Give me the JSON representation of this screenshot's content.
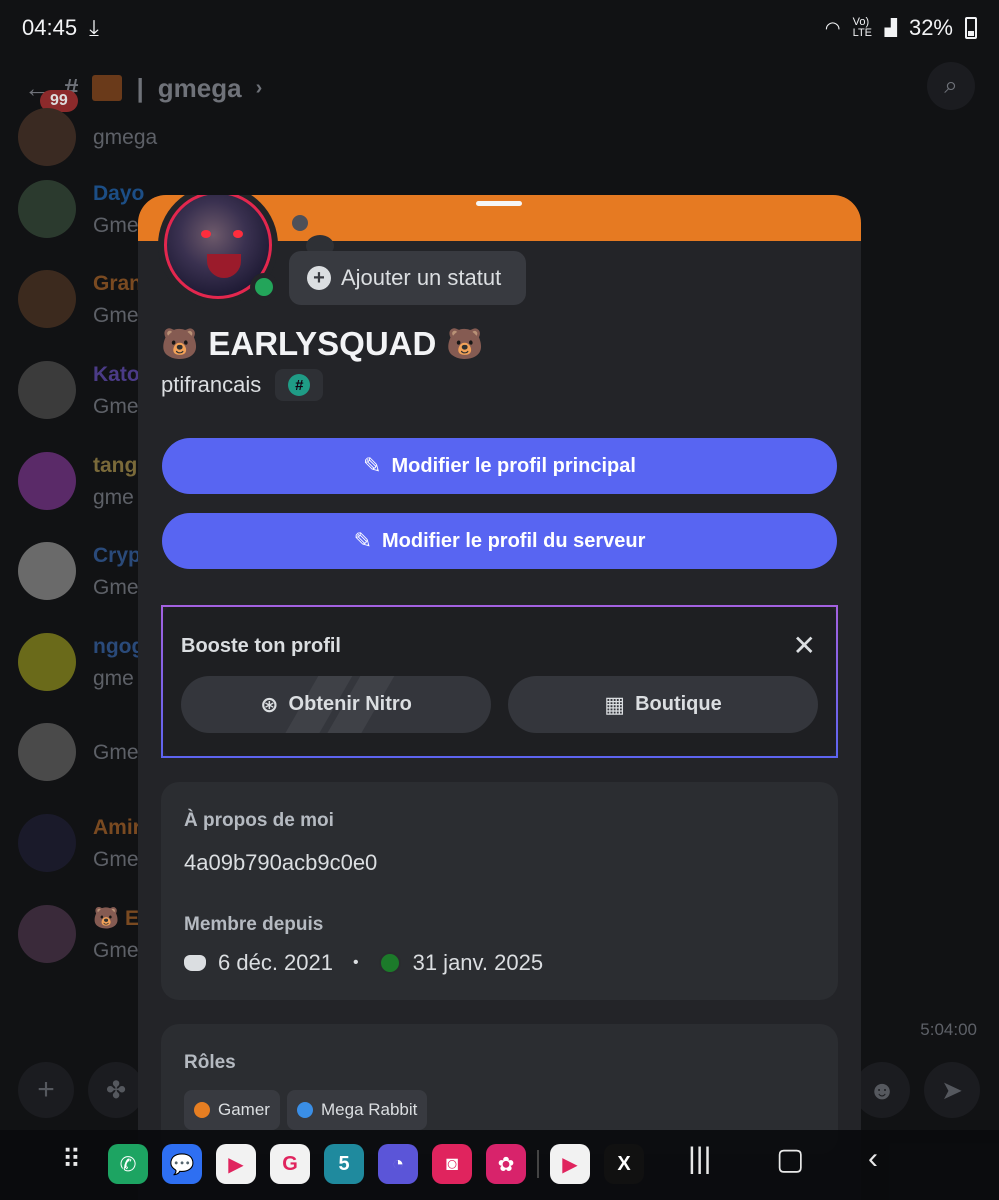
{
  "statusbar": {
    "time": "04:45",
    "battery": "32%",
    "net": "Vo) LTE"
  },
  "background": {
    "channel": "gmega",
    "badge": "99",
    "messages": [
      {
        "name": "",
        "text": "gmega",
        "color": "#5d6067",
        "avatar": "#3a2a22"
      },
      {
        "name": "Dayo",
        "text": "Gme",
        "color": "#1c4e86",
        "avatar": "#2b3a2e"
      },
      {
        "name": "Gran",
        "text": "Gme",
        "color": "#7a4a21",
        "avatar": "#3c2a1e"
      },
      {
        "name": "Kato",
        "text": "Gme",
        "color": "#4b3b87",
        "avatar": "#3b3b3b"
      },
      {
        "name": "tang",
        "text": "gme",
        "color": "#7a6a3a",
        "avatar": "#5a2a68"
      },
      {
        "name": "Cryp",
        "text": "Gme",
        "color": "#2a4a7a",
        "avatar": "#6a6a6a"
      },
      {
        "name": "ngog",
        "text": "gme",
        "color": "#2a4a7a",
        "avatar": "#6a6a1a"
      },
      {
        "name": "",
        "text": "Gme",
        "color": "#4a2a6a",
        "avatar": "#4a4a4a"
      },
      {
        "name": "Amir",
        "text": "Gme",
        "color": "#7a4a21",
        "avatar": "#1a1a2a"
      },
      {
        "name": "🐻 E",
        "text": "Gme",
        "color": "#7a4a21",
        "avatar": "#3a2a3a"
      }
    ],
    "timestamp": "5:04:00"
  },
  "profile": {
    "display_name": "EARLYSQUAD",
    "name_emoji": "🐻",
    "username": "ptifrancais",
    "tag_symbol": "#",
    "status_button": "Ajouter un statut",
    "status_plus": "+"
  },
  "actions": {
    "edit_main": "Modifier le profil principal",
    "edit_server": "Modifier le profil du serveur"
  },
  "boost": {
    "title": "Booste ton profil",
    "close": "✕",
    "nitro": "Obtenir Nitro",
    "shop": "Boutique"
  },
  "about": {
    "label": "À propos de moi",
    "value": "4a09b790acb9c0e0",
    "member_label": "Membre depuis",
    "discord_date": "6 déc. 2021",
    "separator": "•",
    "server_date": "31 janv. 2025"
  },
  "roles": {
    "label": "Rôles",
    "items": [
      {
        "name": "Gamer",
        "color": "#e67e22"
      },
      {
        "name": "Mega Rabbit",
        "color": "#3a8ee6"
      }
    ]
  },
  "navbar": {
    "apps": [
      {
        "name": "phone",
        "color": "#1da462",
        "glyph": "✆"
      },
      {
        "name": "messages",
        "color": "#2e6ff2",
        "glyph": "💬"
      },
      {
        "name": "play-store",
        "color": "#f2f2f2",
        "glyph": "▶"
      },
      {
        "name": "google-photos",
        "color": "#f2f2f2",
        "glyph": "G"
      },
      {
        "name": "calendar",
        "color": "#1f8a9e",
        "glyph": "5"
      },
      {
        "name": "samsung-internet",
        "color": "#5b55d8",
        "glyph": "◔"
      },
      {
        "name": "camera",
        "color": "#e0245e",
        "glyph": "◙"
      },
      {
        "name": "blossom",
        "color": "#d8236b",
        "glyph": "✿"
      },
      {
        "name": "youtube",
        "color": "#f2f2f2",
        "glyph": "▶"
      },
      {
        "name": "x",
        "color": "#111111",
        "glyph": "X"
      }
    ]
  }
}
